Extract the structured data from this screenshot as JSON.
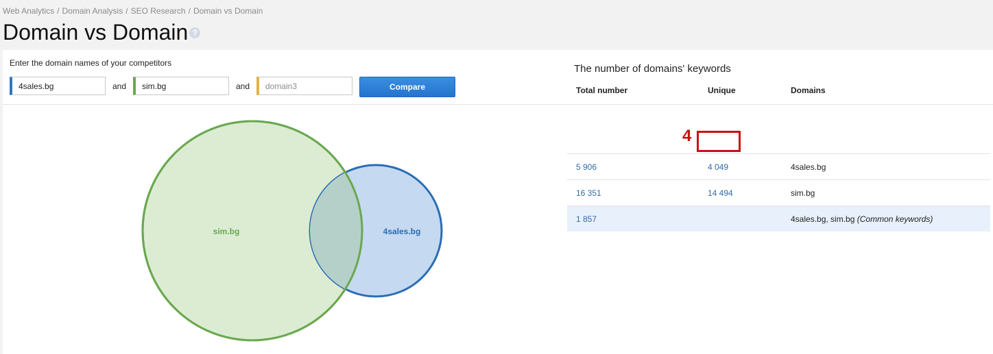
{
  "breadcrumb": {
    "items": [
      "Web Analytics",
      "Domain Analysis",
      "SEO Research",
      "Domain vs Domain"
    ],
    "separator": "/"
  },
  "page": {
    "title": "Domain vs Domain",
    "help_icon": "question-circle-icon"
  },
  "form": {
    "label": "Enter the domain names of your competitors",
    "domain1": {
      "value": "4sales.bg",
      "accent": "#2f76c0"
    },
    "domain2": {
      "value": "sim.bg",
      "accent": "#6aa84f"
    },
    "domain3": {
      "value": "",
      "placeholder": "domain3",
      "accent": "#e2b53c"
    },
    "and_label": "and",
    "compare_label": "Compare"
  },
  "venn": {
    "circles": [
      {
        "label": "sim.bg",
        "stroke": "#6aa84f",
        "fill": "#dcecd3",
        "label_color": "#6aa84f"
      },
      {
        "label": "4sales.bg",
        "stroke": "#2a6db5",
        "fill": "#c5d9f0",
        "label_color": "#2a6db5"
      }
    ],
    "overlap_fill": "#b5d0c8"
  },
  "table": {
    "title": "The number of domains' keywords",
    "headers": {
      "total": "Total number",
      "unique": "Unique",
      "domains": "Domains"
    },
    "rows": [
      {
        "total": "5 906",
        "unique": "4 049",
        "domains": "4sales.bg",
        "note": ""
      },
      {
        "total": "16 351",
        "unique": "14 494",
        "domains": "sim.bg",
        "note": ""
      },
      {
        "total": "1 857",
        "unique": "",
        "domains": "4sales.bg, sim.bg",
        "note": "(Common keywords)"
      }
    ]
  },
  "annotation": {
    "number": "4",
    "color": "#cc1010"
  }
}
